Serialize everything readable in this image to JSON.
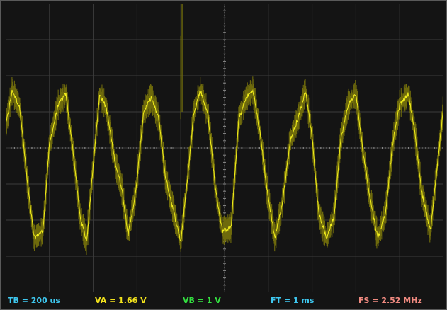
{
  "status_bar": {
    "timebase": "TB = 200 us",
    "channel_a": "VA = 1.66 V",
    "channel_b": "VB = 1 V",
    "frame_time": "FT = 1 ms",
    "sample_rate": "FS = 2.52 MHz"
  },
  "colors": {
    "background": "#141414",
    "grid_line": "#3c3c3c",
    "axis": "#8a8a8a",
    "trace_envelope": "#6e6a0c",
    "trace_center": "#f2ee1c",
    "timebase_text": "#3ec8f0",
    "channel_a_text": "#f2e21c",
    "channel_b_text": "#33e040",
    "frame_time_text": "#3ec8f0",
    "sample_rate_text": "#f08a80"
  },
  "chart_data": {
    "type": "line",
    "title": "",
    "xlabel": "",
    "ylabel": "",
    "xlim": [
      0,
      2000
    ],
    "ylim": [
      -4,
      4
    ],
    "x_unit": "us",
    "y_unit": "div",
    "grid": true,
    "divisions": {
      "x": 10,
      "y": 8
    },
    "series": [
      {
        "x": [
          0,
          30,
          65,
          100,
          130,
          170,
          200,
          240,
          275,
          310,
          340,
          370,
          405,
          430,
          460,
          500,
          530,
          560,
          595,
          630,
          665,
          700,
          730,
          765,
          800,
          835,
          860,
          890,
          925,
          960,
          990,
          1030,
          1065,
          1100,
          1130,
          1165,
          1195,
          1230,
          1265,
          1300,
          1340,
          1370,
          1400,
          1430,
          1465,
          1500,
          1530,
          1565,
          1600,
          1630,
          1665,
          1700,
          1735,
          1770,
          1800,
          1840,
          1870,
          1900,
          1940,
          1970,
          2000
        ],
        "y": [
          0.6,
          1.6,
          1.1,
          -1.0,
          -2.5,
          -2.3,
          0.1,
          1.2,
          1.5,
          -0.2,
          -1.9,
          -2.6,
          -0.1,
          1.5,
          1.1,
          -0.4,
          -1.1,
          -2.4,
          -1.2,
          1.0,
          1.4,
          0.8,
          -0.8,
          -1.7,
          -2.6,
          -0.6,
          1.0,
          1.6,
          0.9,
          -1.2,
          -2.3,
          -2.2,
          0.8,
          1.4,
          1.6,
          0.3,
          -1.2,
          -2.5,
          -1.5,
          0.2,
          0.9,
          1.6,
          0.3,
          -1.8,
          -2.5,
          -1.9,
          0.2,
          1.2,
          1.5,
          0.0,
          -1.4,
          -2.5,
          -1.8,
          0.2,
          1.2,
          1.5,
          0.4,
          -1.2,
          -2.3,
          -0.6,
          1.1
        ]
      }
    ]
  }
}
